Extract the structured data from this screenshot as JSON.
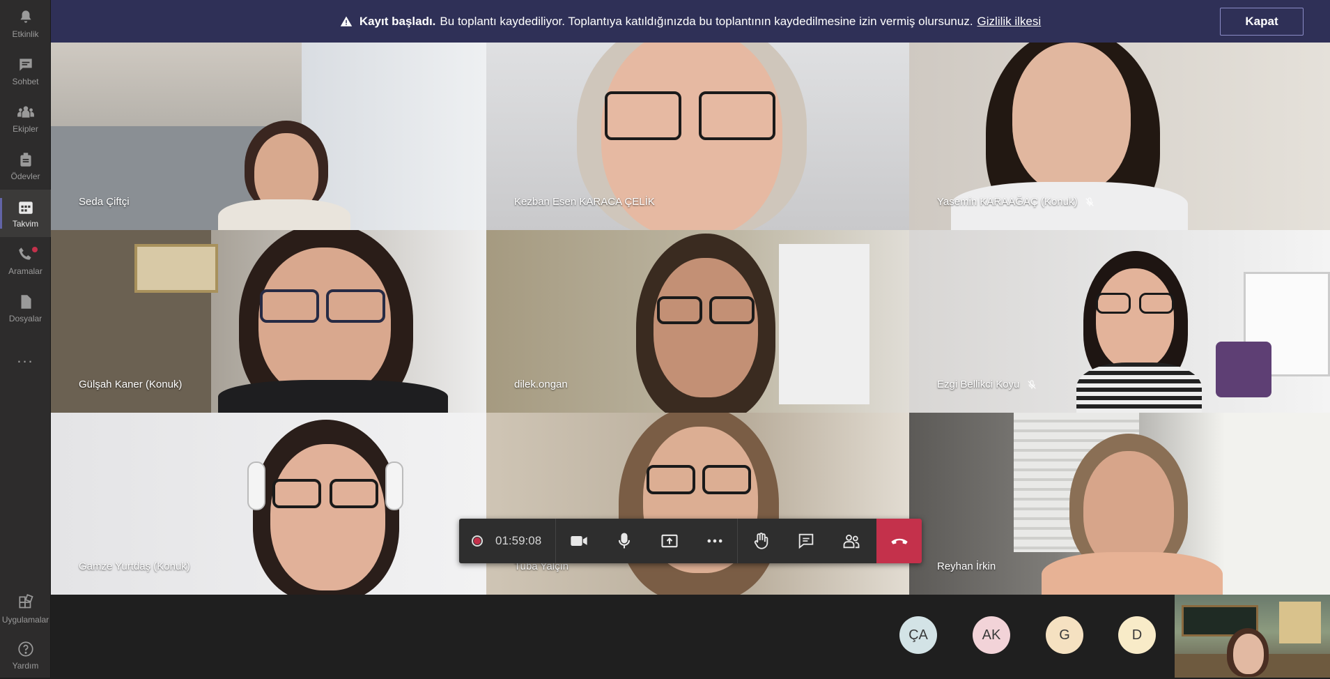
{
  "rail": {
    "items": [
      {
        "label": "Etkinlik",
        "icon": "bell-icon"
      },
      {
        "label": "Sohbet",
        "icon": "chat-icon"
      },
      {
        "label": "Ekipler",
        "icon": "teams-icon"
      },
      {
        "label": "Ödevler",
        "icon": "assignments-icon"
      },
      {
        "label": "Takvim",
        "icon": "calendar-icon"
      },
      {
        "label": "Aramalar",
        "icon": "phone-icon"
      },
      {
        "label": "Dosyalar",
        "icon": "file-icon"
      }
    ],
    "more": "...",
    "apps_label": "Uygulamalar",
    "help_label": "Yardım"
  },
  "banner": {
    "bold": "Kayıt başladı.",
    "text": "Bu toplantı kaydediliyor. Toplantıya katıldığınızda bu toplantının kaydedilmesine izin vermiş olursunuz.",
    "link": "Gizlilik ilkesi",
    "close": "Kapat"
  },
  "participants": [
    "Seda Çiftçi",
    "Kezban Esen KARACA ÇELİK",
    "Yasemin KARAAĞAÇ (Konuk)",
    "Gülşah Kaner (Konuk)",
    "dilek.ongan",
    "Ezgi Bellikci Koyu",
    "Gamze Yurtdaş (Konuk)",
    "Tuba Yalçın",
    "Reyhan İrkin"
  ],
  "call": {
    "timer": "01:59:08"
  },
  "avatars": [
    {
      "initials": "ÇA",
      "color": "#d3e3e6"
    },
    {
      "initials": "AK",
      "color": "#f2d3d8"
    },
    {
      "initials": "G",
      "color": "#f5e1c1"
    },
    {
      "initials": "D",
      "color": "#f8ebc8"
    }
  ]
}
